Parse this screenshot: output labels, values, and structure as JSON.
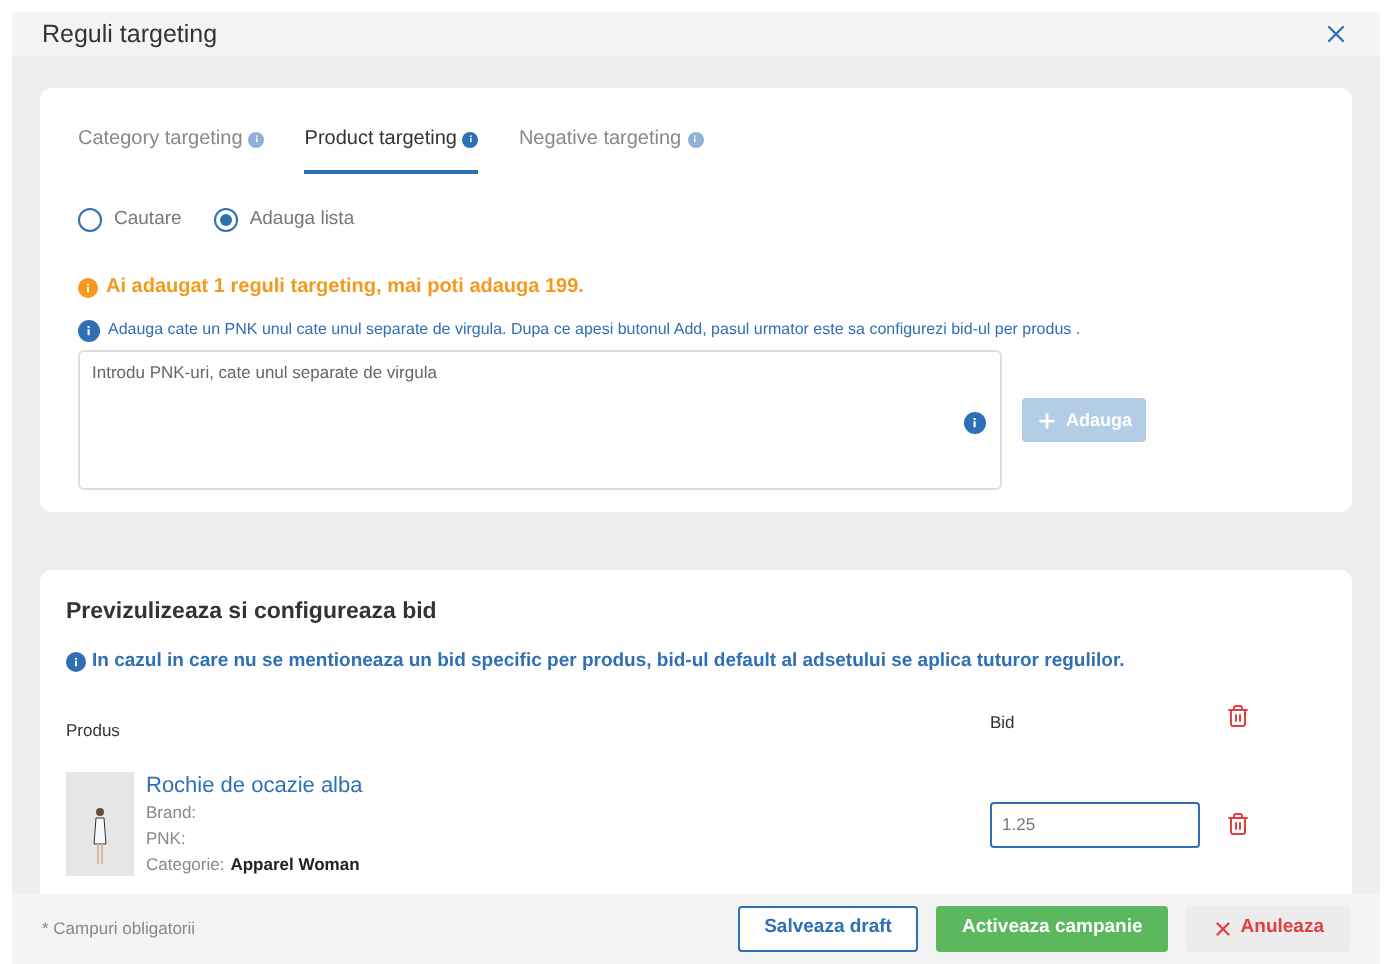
{
  "modal": {
    "title": "Reguli targeting"
  },
  "tabs": [
    {
      "label": "Category targeting",
      "selected": false
    },
    {
      "label": "Product targeting",
      "selected": true
    },
    {
      "label": "Negative targeting",
      "selected": false
    }
  ],
  "radios": [
    {
      "label": "Cautare",
      "selected": false
    },
    {
      "label": "Adauga lista",
      "selected": true
    }
  ],
  "warning": "Ai adaugat 1 reguli targeting, mai poti adauga 199.",
  "hint": "Adauga cate un PNK unul cate unul separate de virgula. Dupa ce apesi butonul Add, pasul urmator este sa configurezi bid-ul per produs .",
  "pnk_field": {
    "placeholder": "Introdu PNK-uri, cate unul separate de virgula"
  },
  "add_button": {
    "label": "Adauga",
    "disabled": true
  },
  "preview": {
    "title": "Previzulizeaza si configureaza bid",
    "note": "In cazul in care nu se mentioneaza un bid specific per produs, bid-ul default al adsetului se aplica tuturor regulilor.",
    "columns": [
      "Produs",
      "Bid"
    ],
    "rows": [
      {
        "name": "Rochie de ocazie alba",
        "brand_label": "Brand:",
        "pnk_label": "PNK:",
        "category_label": "Categorie:",
        "category": "Apparel Woman",
        "bid": "1.25"
      }
    ]
  },
  "footer": {
    "required_note": "* Campuri obligatorii",
    "buttons": [
      {
        "label": "Salveaza draft",
        "kind": "outline"
      },
      {
        "label": "Activeaza campanie",
        "kind": "primary"
      },
      {
        "label": "Anuleaza",
        "kind": "cancel"
      }
    ]
  }
}
